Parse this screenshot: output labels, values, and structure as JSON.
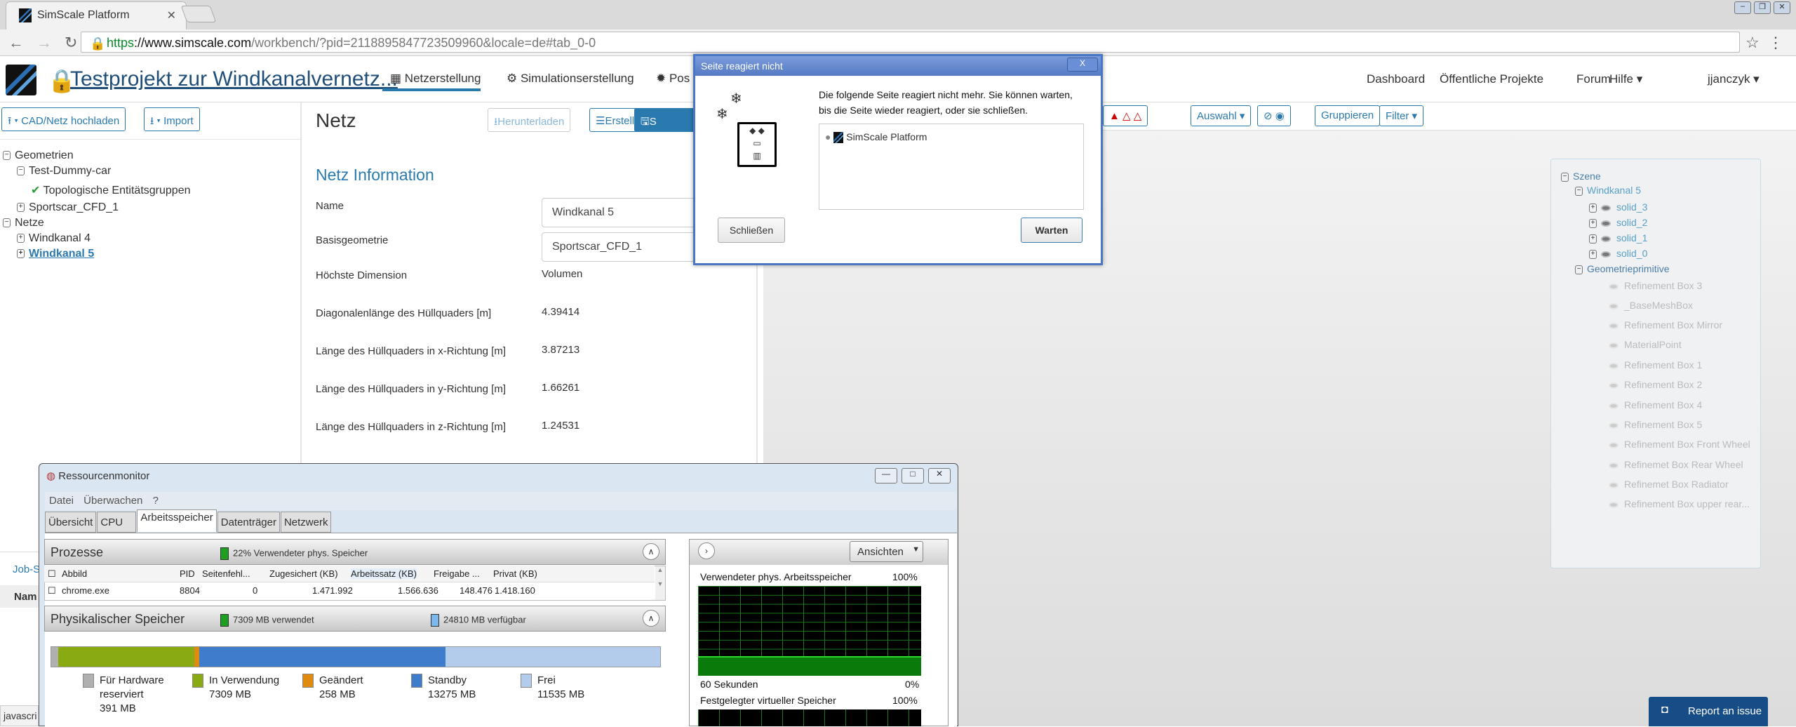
{
  "browser": {
    "tab_title": "SimScale Platform",
    "url_scheme": "https",
    "url_host": "://www.simscale.com",
    "url_rest": "/workbench/?pid=2118895847723509960&locale=de#tab_0-0",
    "status_text": "javascri"
  },
  "header": {
    "project_title": "Testprojekt zur Windkanalvernetz...",
    "nav": [
      "Netzerstellung",
      "Simulationserstellung",
      "Pos"
    ],
    "right_nav": [
      "Dashboard",
      "Öffentliche Projekte",
      "Forum",
      "Hilfe ▾",
      "jjanczyk ▾"
    ]
  },
  "left": {
    "upload_label": "▾ CAD/Netz hochladen",
    "import_label": "▾ Import",
    "tree": [
      "Geometrien",
      "Test-Dummy-car",
      "Topologische Entitätsgruppen",
      "Sportscar_CFD_1",
      "Netze",
      "Windkanal 4",
      "Windkanal 5"
    ],
    "job_tab": "Job-S",
    "name_header": "Nam"
  },
  "mesh": {
    "title": "Netz",
    "download": "Herunterladen",
    "create": "Erstellen",
    "save": "S",
    "info_title": "Netz Information",
    "rows": [
      {
        "label": "Name",
        "value": "Windkanal 5"
      },
      {
        "label": "Basisgeometrie",
        "value": "Sportscar_CFD_1"
      },
      {
        "label": "Höchste Dimension",
        "value": "Volumen"
      },
      {
        "label": "Diagonalenlänge des Hüllquaders [m]",
        "value": "4.39414"
      },
      {
        "label": "Länge des Hüllquaders in x-Richtung [m]",
        "value": "3.87213"
      },
      {
        "label": "Länge des Hüllquaders in y-Richtung [m]",
        "value": "1.66261"
      },
      {
        "label": "Länge des Hüllquaders in z-Richtung [m]",
        "value": "1.24531"
      }
    ]
  },
  "viewer": {
    "select": "Auswahl ▾",
    "group": "Gruppieren",
    "filter": "Filter ▾",
    "scene": {
      "root": "Szene",
      "mesh": "Windkanal 5",
      "solids": [
        "solid_3",
        "solid_2",
        "solid_1",
        "solid_0"
      ],
      "primitives_label": "Geometrieprimitive",
      "primitives": [
        "Refinement Box 3",
        "_BaseMeshBox",
        "Refinement Box Mirror",
        "MaterialPoint",
        "Refinement Box 1",
        "Refinement Box 2",
        "Refinement Box 4",
        "Refinement Box 5",
        "Refinement Box Front Wheel",
        "Refinemet Box Rear Wheel",
        "Refinemet Box Radiator",
        "Refinement Box upper rear..."
      ]
    }
  },
  "dialog": {
    "title": "Seite reagiert nicht",
    "message": "Die folgende Seite reagiert nicht mehr. Sie können warten, bis die Seite wieder reagiert, oder sie schließen.",
    "page": "SimScale Platform",
    "close": "Schließen",
    "wait": "Warten"
  },
  "resmon": {
    "title": "Ressourcenmonitor",
    "menu": "Datei Überwachen ?",
    "tabs": [
      "Übersicht",
      "CPU",
      "Arbeitsspeicher",
      "Datenträger",
      "Netzwerk"
    ],
    "processes": "Prozesse",
    "proc_meter": "22% Verwendeter phys. Speicher",
    "columns": [
      "Abbild",
      "PID",
      "Seitenfehl...",
      "Zugesichert (KB)",
      "Arbeitssatz (KB)",
      "Freigabe ...",
      "Privat (KB)"
    ],
    "row": [
      "chrome.exe",
      "8804",
      "0",
      "1.471.992",
      "1.566.636",
      "148.476",
      "1.418.160"
    ],
    "physical": "Physikalischer Speicher",
    "used": "7309 MB verwendet",
    "available": "24810 MB verfügbar",
    "memory_bar": [
      {
        "label": "Für Hardware reserviert",
        "value": "391 MB",
        "mb": 391,
        "color": "#b0b0b0"
      },
      {
        "label": "In Verwendung",
        "value": "7309 MB",
        "mb": 7309,
        "color": "#8aaa14"
      },
      {
        "label": "Geändert",
        "value": "258 MB",
        "mb": 258,
        "color": "#e08a10"
      },
      {
        "label": "Standby",
        "value": "13275 MB",
        "mb": 13275,
        "color": "#3f7ccc"
      },
      {
        "label": "Frei",
        "value": "11535 MB",
        "mb": 11535,
        "color": "#b4ccec"
      }
    ],
    "views": "Ansichten",
    "graph1_title": "Verwendeter phys. Arbeitsspeicher",
    "graph_max": "100%",
    "graph_time": "60 Sekunden",
    "graph_min": "0%",
    "graph2_title": "Festgelegter virtueller Speicher",
    "graph1_percent": 22
  },
  "report": "Report an issue"
}
